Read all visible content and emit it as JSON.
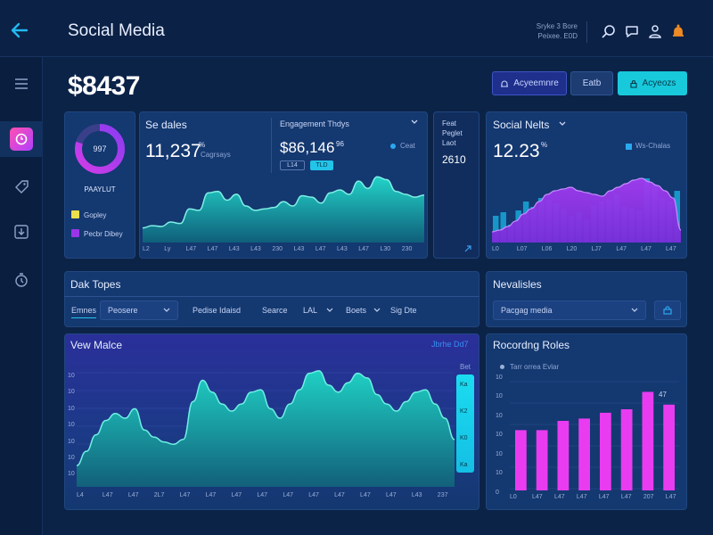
{
  "header": {
    "title": "Social Media",
    "info_line1": "Sryke 3 Bore",
    "info_line2": "Peixee. E0D",
    "icons": [
      "search-icon",
      "chat-icon",
      "user-icon",
      "notification-icon"
    ]
  },
  "sidebar": {
    "items": [
      "menu-icon",
      "clock-icon",
      "tag-icon",
      "download-icon",
      "timer-icon"
    ]
  },
  "balance": "$8437",
  "toolbar": {
    "btn1": "Acyeemnre",
    "btn2": "Eatb",
    "btn3": "Acyeozs"
  },
  "donut": {
    "center": "997",
    "label": "PAAYLUT",
    "legend1": "Gopley",
    "legend2": "Pecbr Dibey",
    "colors": {
      "primary": "#9a35e8",
      "secondary": "#e8e04c"
    }
  },
  "sales": {
    "title": "Se dales",
    "value": "11,237",
    "sup": "%",
    "note": "Cagrsays",
    "ticks": [
      "L2",
      "Ly",
      "L47",
      "L47",
      "L43",
      "L43",
      "230",
      "L43",
      "L47",
      "L43",
      "L47",
      "L30",
      "230"
    ],
    "series": [
      20,
      23,
      22,
      28,
      26,
      46,
      44,
      68,
      70,
      58,
      66,
      50,
      44,
      46,
      48,
      56,
      50,
      64,
      62,
      54,
      68,
      72,
      66,
      84,
      74,
      90,
      86,
      70,
      66,
      62,
      65
    ]
  },
  "engagement": {
    "title": "Engagement Thdys",
    "value": "$86,146",
    "sup": "96",
    "legend": "Ceat",
    "pill1": "L14",
    "pill2": "TLD"
  },
  "narrow": {
    "line1": "Feat",
    "line2": "Peglet",
    "line3": "Laot",
    "value": "2610"
  },
  "social": {
    "title": "Social Nelts",
    "value": "12.23",
    "sup": "%",
    "legend": "Ws-Chalas",
    "ticks": [
      "L0",
      "L07",
      "L06",
      "L20",
      "LJ7",
      "L47",
      "L47",
      "L47"
    ],
    "bars": [
      30,
      34,
      20,
      36,
      46,
      40,
      50,
      48,
      44,
      38,
      30,
      34,
      26,
      42,
      46,
      48,
      54,
      40,
      38,
      36,
      72,
      64,
      50,
      46,
      58
    ],
    "area": [
      12,
      14,
      18,
      24,
      32,
      38,
      46,
      54,
      58,
      60,
      62,
      58,
      56,
      54,
      52,
      58,
      62,
      66,
      70,
      72,
      68,
      64,
      58,
      50,
      14
    ]
  },
  "topics": {
    "title": "Dak Topes",
    "tab1": "Emnes",
    "select": "Peosere",
    "filters": [
      "Pedise Idaisd",
      "Searce",
      "LAL",
      "Boets",
      "Sig Dte"
    ]
  },
  "newsletters": {
    "title": "Nevalisles",
    "select": "Pacgag media"
  },
  "view": {
    "title": "Vew Malce",
    "link": "Jbrhe Dd7",
    "right_label": "Bet",
    "y_ticks": [
      "10",
      "10",
      "10",
      "10",
      "10",
      "10",
      "10"
    ],
    "x_ticks": [
      "L4",
      "L47",
      "L47",
      "2L7",
      "L47",
      "L47",
      "L47",
      "L47",
      "L47",
      "L47",
      "L47",
      "L47",
      "L47",
      "L43",
      "237"
    ],
    "scroll_labels": [
      "Ka",
      "K2",
      "K0",
      "Ka"
    ],
    "series": [
      18,
      30,
      44,
      56,
      62,
      58,
      66,
      48,
      42,
      38,
      36,
      40,
      72,
      90,
      80,
      70,
      64,
      70,
      80,
      82,
      66,
      58,
      70,
      82,
      96,
      98,
      86,
      80,
      88,
      96,
      92,
      78,
      70,
      64,
      72,
      80,
      82,
      70,
      58,
      40
    ]
  },
  "recording": {
    "title": "Rocordng Roles",
    "legend": "Tarr orrea Evlar",
    "y_ticks": [
      "10",
      "10",
      "10",
      "10",
      "10",
      "10",
      "0"
    ],
    "x_ticks": [
      "L0",
      "L47",
      "L47",
      "L47",
      "L47",
      "L47",
      "207",
      "L47"
    ],
    "top_label": "47",
    "values": [
      52,
      52,
      60,
      62,
      67,
      70,
      85,
      74
    ]
  },
  "chart_data": [
    {
      "type": "area",
      "title": "Se dales",
      "x": [
        "L2",
        "Ly",
        "L47",
        "L47",
        "L43",
        "L43",
        "230",
        "L43",
        "L47",
        "L43",
        "L47",
        "L30",
        "230"
      ],
      "values": [
        20,
        23,
        22,
        28,
        26,
        46,
        44,
        68,
        70,
        58,
        66,
        50,
        44,
        46,
        48,
        56,
        50,
        64,
        62,
        54,
        68,
        72,
        66,
        84,
        74,
        90,
        86,
        70,
        66,
        62,
        65
      ]
    },
    {
      "type": "bar",
      "title": "Social Nelts",
      "values": [
        30,
        34,
        20,
        36,
        46,
        40,
        50,
        48,
        44,
        38,
        30,
        34,
        26,
        42,
        46,
        48,
        54,
        40,
        38,
        36,
        72,
        64,
        50,
        46,
        58
      ]
    },
    {
      "type": "area",
      "title": "Vew Malce",
      "values": [
        18,
        30,
        44,
        56,
        62,
        58,
        66,
        48,
        42,
        38,
        36,
        40,
        72,
        90,
        80,
        70,
        64,
        70,
        80,
        82,
        66,
        58,
        70,
        82,
        96,
        98,
        86,
        80,
        88,
        96,
        92,
        78,
        70,
        64,
        72,
        80,
        82,
        70,
        58,
        40
      ]
    },
    {
      "type": "bar",
      "title": "Rocordng Roles",
      "categories": [
        "L0",
        "L47",
        "L47",
        "L47",
        "L47",
        "L47",
        "207",
        "L47"
      ],
      "values": [
        52,
        52,
        60,
        62,
        67,
        70,
        85,
        74
      ]
    }
  ]
}
